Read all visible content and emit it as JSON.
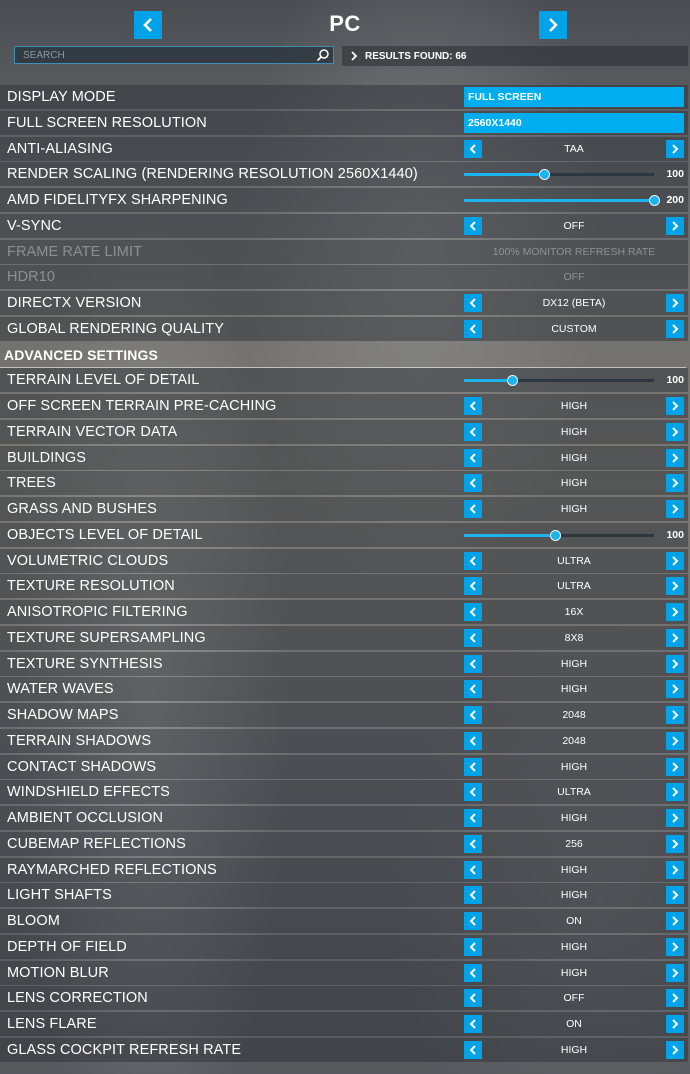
{
  "header": {
    "title": "PC"
  },
  "search": {
    "placeholder": "SEARCH",
    "results_label": "RESULTS FOUND: 66"
  },
  "settings": [
    {
      "label": "DISPLAY MODE",
      "type": "field",
      "value": "FULL SCREEN"
    },
    {
      "label": "FULL SCREEN RESOLUTION",
      "type": "field",
      "value": "2560X1440"
    },
    {
      "label": "ANTI-ALIASING",
      "type": "choice",
      "value": "TAA"
    },
    {
      "label": "RENDER SCALING (RENDERING RESOLUTION 2560X1440)",
      "type": "slider",
      "value": "100",
      "fraction": 0.42
    },
    {
      "label": "AMD FIDELITYFX SHARPENING",
      "type": "slider",
      "value": "200",
      "fraction": 1.0
    },
    {
      "label": "V-SYNC",
      "type": "choice",
      "value": "OFF"
    },
    {
      "label": "FRAME RATE LIMIT",
      "type": "disabled",
      "value": "100% MONITOR REFRESH RATE"
    },
    {
      "label": "HDR10",
      "type": "disabled",
      "value": "OFF"
    },
    {
      "label": "DIRECTX VERSION",
      "type": "choice",
      "value": "DX12 (BETA)"
    },
    {
      "label": "GLOBAL RENDERING QUALITY",
      "type": "choice",
      "value": "CUSTOM"
    },
    {
      "label": "ADVANCED SETTINGS",
      "type": "section"
    },
    {
      "label": "TERRAIN LEVEL OF DETAIL",
      "type": "slider",
      "value": "100",
      "fraction": 0.25
    },
    {
      "label": "OFF SCREEN TERRAIN PRE-CACHING",
      "type": "choice",
      "value": "HIGH"
    },
    {
      "label": "TERRAIN VECTOR DATA",
      "type": "choice",
      "value": "HIGH"
    },
    {
      "label": "BUILDINGS",
      "type": "choice",
      "value": "HIGH"
    },
    {
      "label": "TREES",
      "type": "choice",
      "value": "HIGH"
    },
    {
      "label": "GRASS AND BUSHES",
      "type": "choice",
      "value": "HIGH"
    },
    {
      "label": "OBJECTS LEVEL OF DETAIL",
      "type": "slider",
      "value": "100",
      "fraction": 0.48
    },
    {
      "label": "VOLUMETRIC CLOUDS",
      "type": "choice",
      "value": "ULTRA"
    },
    {
      "label": "TEXTURE RESOLUTION",
      "type": "choice",
      "value": "ULTRA"
    },
    {
      "label": "ANISOTROPIC FILTERING",
      "type": "choice",
      "value": "16X"
    },
    {
      "label": "TEXTURE SUPERSAMPLING",
      "type": "choice",
      "value": "8X8"
    },
    {
      "label": "TEXTURE SYNTHESIS",
      "type": "choice",
      "value": "HIGH"
    },
    {
      "label": "WATER WAVES",
      "type": "choice",
      "value": "HIGH"
    },
    {
      "label": "SHADOW MAPS",
      "type": "choice",
      "value": "2048"
    },
    {
      "label": "TERRAIN SHADOWS",
      "type": "choice",
      "value": "2048"
    },
    {
      "label": "CONTACT SHADOWS",
      "type": "choice",
      "value": "HIGH"
    },
    {
      "label": "WINDSHIELD EFFECTS",
      "type": "choice",
      "value": "ULTRA"
    },
    {
      "label": "AMBIENT OCCLUSION",
      "type": "choice",
      "value": "HIGH"
    },
    {
      "label": "CUBEMAP REFLECTIONS",
      "type": "choice",
      "value": "256"
    },
    {
      "label": "RAYMARCHED REFLECTIONS",
      "type": "choice",
      "value": "HIGH"
    },
    {
      "label": "LIGHT SHAFTS",
      "type": "choice",
      "value": "HIGH"
    },
    {
      "label": "BLOOM",
      "type": "choice",
      "value": "ON"
    },
    {
      "label": "DEPTH OF FIELD",
      "type": "choice",
      "value": "HIGH"
    },
    {
      "label": "MOTION BLUR",
      "type": "choice",
      "value": "HIGH"
    },
    {
      "label": "LENS CORRECTION",
      "type": "choice",
      "value": "OFF"
    },
    {
      "label": "LENS FLARE",
      "type": "choice",
      "value": "ON"
    },
    {
      "label": "GLASS COCKPIT REFRESH RATE",
      "type": "choice",
      "value": "HIGH"
    }
  ]
}
